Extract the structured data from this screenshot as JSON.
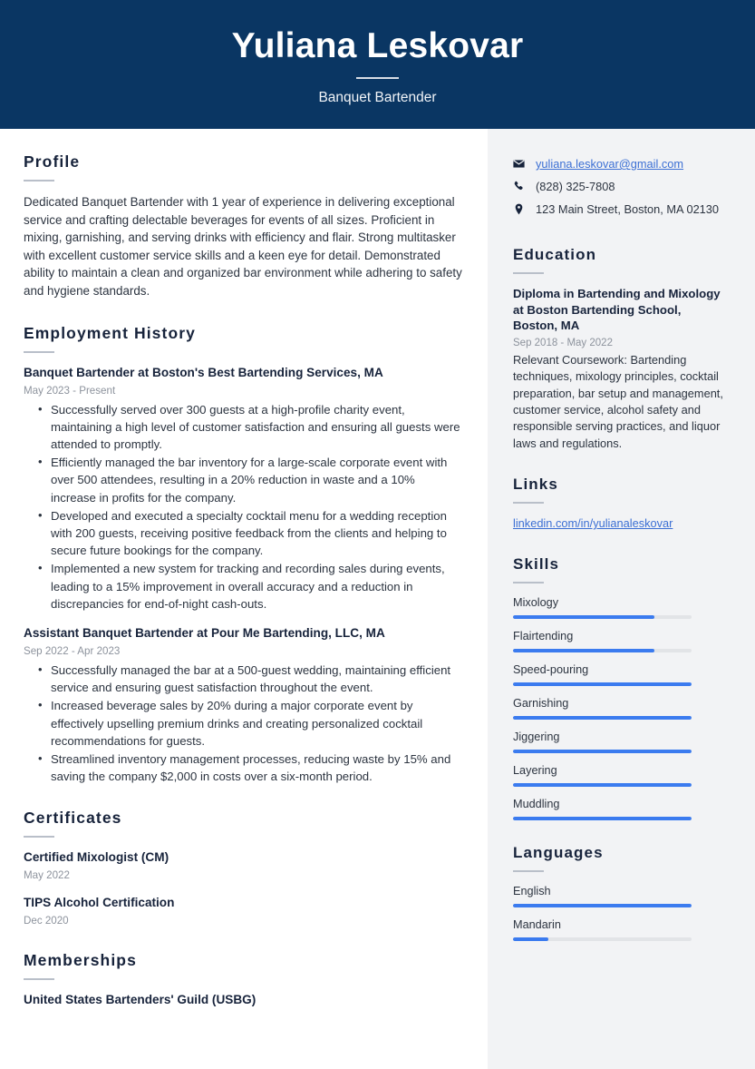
{
  "header": {
    "name": "Yuliana Leskovar",
    "job_title": "Banquet Bartender",
    "bg_color": "#0a3663"
  },
  "theme": {
    "accent_blue": "#3b7bef",
    "link_blue": "#3b6fd4",
    "sidebar_bg": "#f2f3f5",
    "heading_color": "#17233b",
    "muted_text": "#8d939d"
  },
  "main": {
    "profile": {
      "heading": "Profile",
      "text": "Dedicated Banquet Bartender with 1 year of experience in delivering exceptional service and crafting delectable beverages for events of all sizes. Proficient in mixing, garnishing, and serving drinks with efficiency and flair. Strong multitasker with excellent customer service skills and a keen eye for detail. Demonstrated ability to maintain a clean and organized bar environment while adhering to safety and hygiene standards."
    },
    "employment": {
      "heading": "Employment History",
      "jobs": [
        {
          "title": "Banquet Bartender at Boston's Best Bartending Services, MA",
          "date": "May 2023 - Present",
          "bullets": [
            "Successfully served over 300 guests at a high-profile charity event, maintaining a high level of customer satisfaction and ensuring all guests were attended to promptly.",
            "Efficiently managed the bar inventory for a large-scale corporate event with over 500 attendees, resulting in a 20% reduction in waste and a 10% increase in profits for the company.",
            "Developed and executed a specialty cocktail menu for a wedding reception with 200 guests, receiving positive feedback from the clients and helping to secure future bookings for the company.",
            "Implemented a new system for tracking and recording sales during events, leading to a 15% improvement in overall accuracy and a reduction in discrepancies for end-of-night cash-outs."
          ]
        },
        {
          "title": "Assistant Banquet Bartender at Pour Me Bartending, LLC, MA",
          "date": "Sep 2022 - Apr 2023",
          "bullets": [
            "Successfully managed the bar at a 500-guest wedding, maintaining efficient service and ensuring guest satisfaction throughout the event.",
            "Increased beverage sales by 20% during a major corporate event by effectively upselling premium drinks and creating personalized cocktail recommendations for guests.",
            "Streamlined inventory management processes, reducing waste by 15% and saving the company $2,000 in costs over a six-month period."
          ]
        }
      ]
    },
    "certificates": {
      "heading": "Certificates",
      "items": [
        {
          "title": "Certified Mixologist (CM)",
          "date": "May 2022"
        },
        {
          "title": "TIPS Alcohol Certification",
          "date": "Dec 2020"
        }
      ]
    },
    "memberships": {
      "heading": "Memberships",
      "items": [
        {
          "title": "United States Bartenders' Guild (USBG)"
        }
      ]
    }
  },
  "sidebar": {
    "contact": [
      {
        "icon": "envelope-icon",
        "value": "yuliana.leskovar@gmail.com",
        "is_link": true
      },
      {
        "icon": "phone-icon",
        "value": "(828) 325-7808",
        "is_link": false
      },
      {
        "icon": "location-pin-icon",
        "value": "123 Main Street, Boston, MA 02130",
        "is_link": false
      }
    ],
    "education": {
      "heading": "Education",
      "title": "Diploma in Bartending and Mixology at Boston Bartending School, Boston, MA",
      "date": "Sep 2018 - May 2022",
      "description": "Relevant Coursework: Bartending techniques, mixology principles, cocktail preparation, bar setup and management, customer service, alcohol safety and responsible serving practices, and liquor laws and regulations."
    },
    "links": {
      "heading": "Links",
      "items": [
        {
          "label": "linkedin.com/in/yulianaleskovar"
        }
      ]
    },
    "skills": {
      "heading": "Skills",
      "items": [
        {
          "label": "Mixology",
          "level": 79
        },
        {
          "label": "Flairtending",
          "level": 79
        },
        {
          "label": "Speed-pouring",
          "level": 100
        },
        {
          "label": "Garnishing",
          "level": 100
        },
        {
          "label": "Jiggering",
          "level": 100
        },
        {
          "label": "Layering",
          "level": 100
        },
        {
          "label": "Muddling",
          "level": 100
        }
      ]
    },
    "languages": {
      "heading": "Languages",
      "items": [
        {
          "label": "English",
          "level": 100
        },
        {
          "label": "Mandarin",
          "level": 20
        }
      ]
    }
  }
}
